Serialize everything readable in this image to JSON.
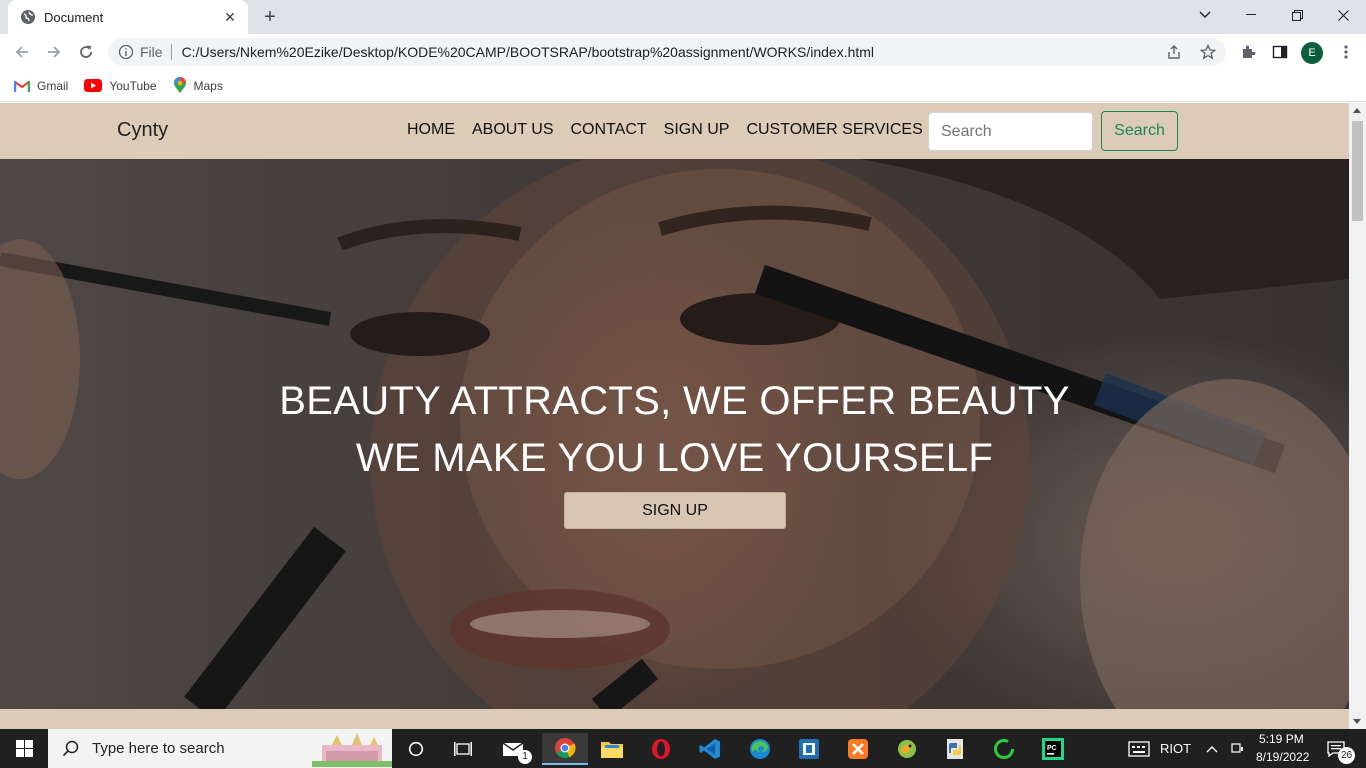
{
  "browser": {
    "tab_title": "Document",
    "address_scheme": "File",
    "url": "C:/Users/Nkem%20Ezike/Desktop/KODE%20CAMP/BOOTSRAP/bootstrap%20assignment/WORKS/index.html",
    "profile_initial": "E",
    "bookmarks": [
      {
        "label": "Gmail",
        "icon": "gmail-icon"
      },
      {
        "label": "YouTube",
        "icon": "youtube-icon"
      },
      {
        "label": "Maps",
        "icon": "maps-icon"
      }
    ]
  },
  "page": {
    "brand": "Cynty",
    "nav": [
      "HOME",
      "ABOUT US",
      "CONTACT",
      "SIGN UP",
      "CUSTOMER SERVICES"
    ],
    "search_placeholder": "Search",
    "search_button": "Search",
    "hero_line1": "BEAUTY ATTRACTS, WE OFFER BEAUTY",
    "hero_line2": "WE MAKE YOU LOVE YOURSELF",
    "hero_button": "SIGN UP",
    "colors": {
      "navbar_bg": "#dccbb7",
      "search_button": "#198754"
    }
  },
  "taskbar": {
    "search_placeholder": "Type here to search",
    "mail_badge": "1",
    "tray_label": "RIOT",
    "time": "5:19 PM",
    "date": "8/19/2022",
    "notification_count": "26"
  }
}
